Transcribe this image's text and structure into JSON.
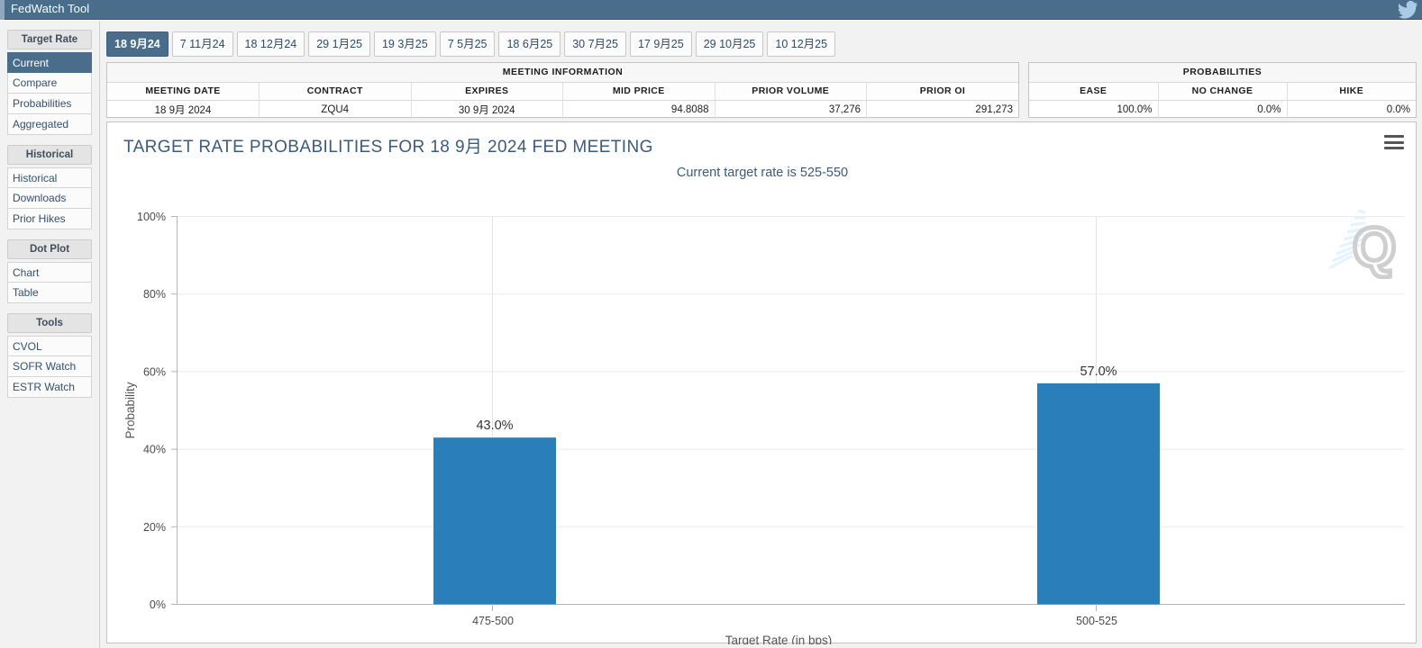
{
  "titlebar": {
    "title": "FedWatch Tool",
    "bird_icon": "bird-icon"
  },
  "sidebar": {
    "groups": [
      {
        "header": "Target Rate",
        "items": [
          {
            "label": "Current",
            "active": true
          },
          {
            "label": "Compare",
            "active": false
          },
          {
            "label": "Probabilities",
            "active": false
          },
          {
            "label": "Aggregated",
            "active": false
          }
        ]
      },
      {
        "header": "Historical",
        "items": [
          {
            "label": "Historical",
            "active": false
          },
          {
            "label": "Downloads",
            "active": false
          },
          {
            "label": "Prior Hikes",
            "active": false
          }
        ]
      },
      {
        "header": "Dot Plot",
        "items": [
          {
            "label": "Chart",
            "active": false
          },
          {
            "label": "Table",
            "active": false
          }
        ]
      },
      {
        "header": "Tools",
        "items": [
          {
            "label": "CVOL",
            "active": false
          },
          {
            "label": "SOFR Watch",
            "active": false
          },
          {
            "label": "ESTR Watch",
            "active": false
          }
        ]
      }
    ]
  },
  "tabs": [
    {
      "label": "18 9月24",
      "active": true
    },
    {
      "label": "7 11月24",
      "active": false
    },
    {
      "label": "18 12月24",
      "active": false
    },
    {
      "label": "29 1月25",
      "active": false
    },
    {
      "label": "19 3月25",
      "active": false
    },
    {
      "label": "7 5月25",
      "active": false
    },
    {
      "label": "18 6月25",
      "active": false
    },
    {
      "label": "30 7月25",
      "active": false
    },
    {
      "label": "17 9月25",
      "active": false
    },
    {
      "label": "29 10月25",
      "active": false
    },
    {
      "label": "10 12月25",
      "active": false
    }
  ],
  "meeting_information": {
    "caption": "MEETING INFORMATION",
    "columns": [
      "MEETING DATE",
      "CONTRACT",
      "EXPIRES",
      "MID PRICE",
      "PRIOR VOLUME",
      "PRIOR OI"
    ],
    "row": {
      "meeting_date": "18 9月 2024",
      "contract": "ZQU4",
      "expires": "30 9月 2024",
      "mid_price": "94.8088",
      "prior_volume": "37,276",
      "prior_oi": "291,273"
    }
  },
  "probabilities_table": {
    "caption": "PROBABILITIES",
    "columns": [
      "EASE",
      "NO CHANGE",
      "HIKE"
    ],
    "row": {
      "ease": "100.0%",
      "no_change": "0.0%",
      "hike": "0.0%"
    }
  },
  "chart_data": {
    "type": "bar",
    "title": "TARGET RATE PROBABILITIES FOR 18 9月 2024 FED MEETING",
    "subtitle": "Current target rate is 525-550",
    "categories": [
      "475-500",
      "500-525"
    ],
    "values": [
      43.0,
      57.0
    ],
    "value_labels": [
      "43.0%",
      "57.0%"
    ],
    "xlabel": "Target Rate (in bps)",
    "ylabel": "Probability",
    "ylim": [
      0,
      100
    ],
    "yticks": [
      0,
      20,
      40,
      60,
      80,
      100
    ],
    "ytick_labels": [
      "0%",
      "20%",
      "40%",
      "60%",
      "80%",
      "100%"
    ],
    "grid": true,
    "legend": "none",
    "bar_color": "#2a7fba",
    "menu_icon": "hamburger-menu-icon",
    "watermark": "Q"
  }
}
